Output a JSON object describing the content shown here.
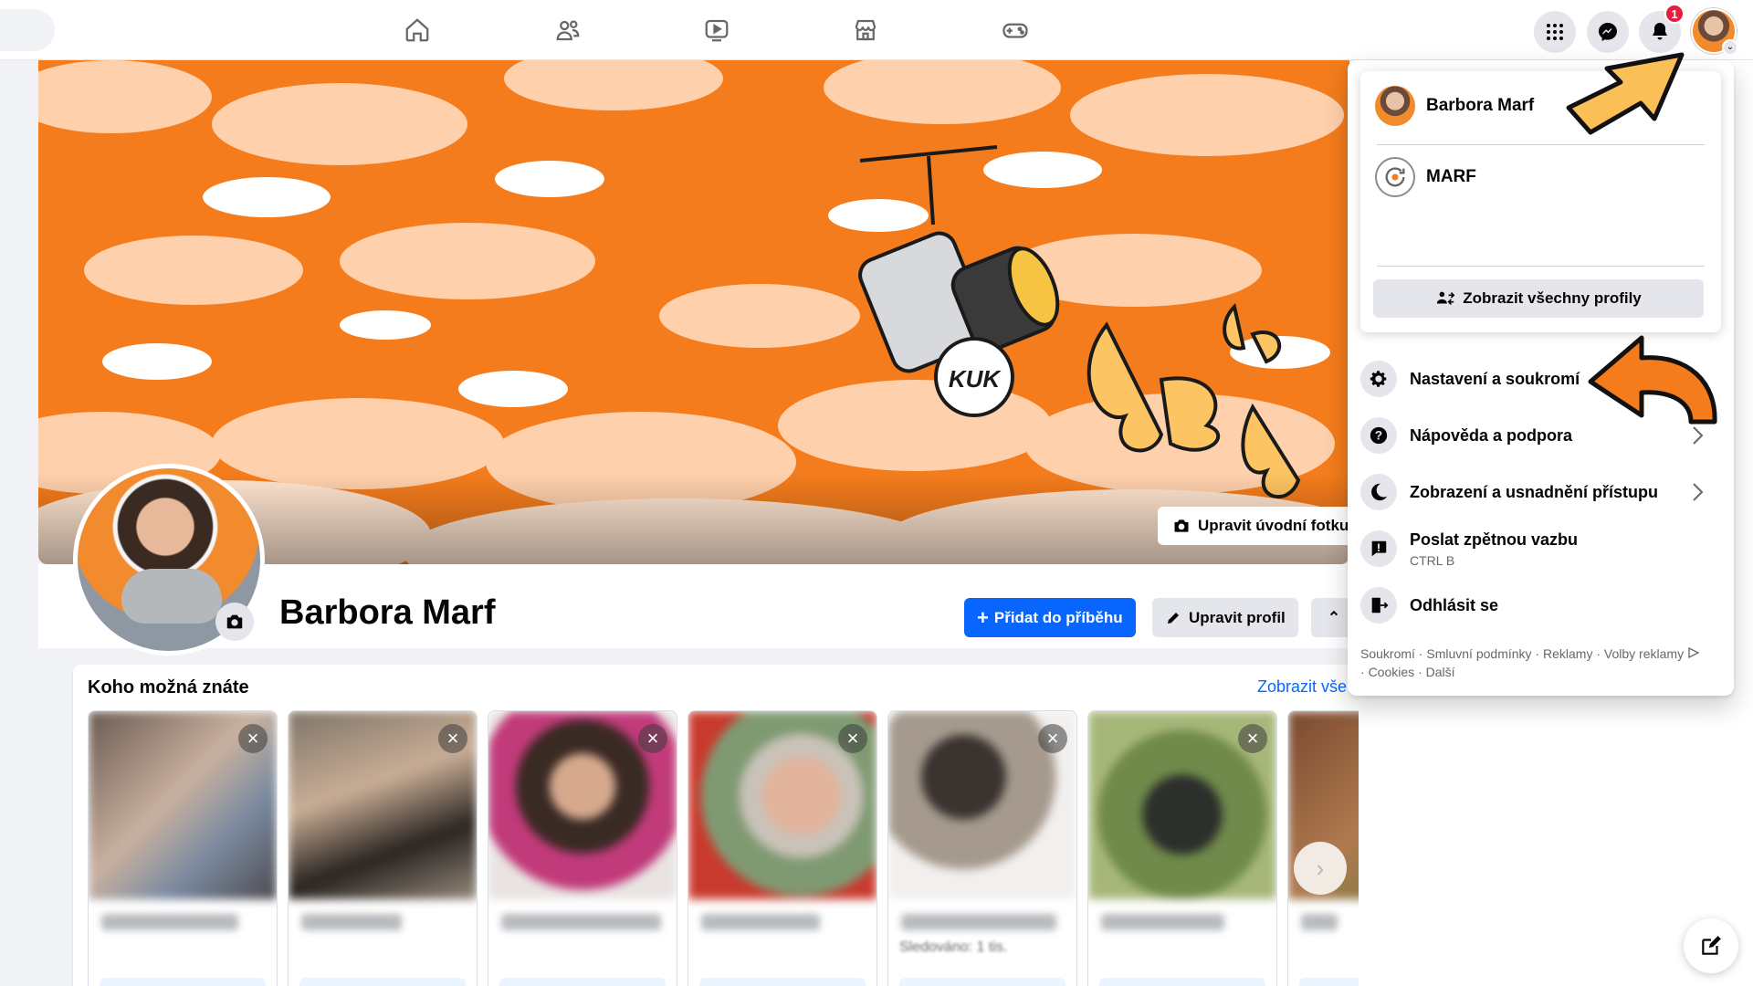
{
  "colors": {
    "accent": "#0866ff",
    "badge": "#e41e3f",
    "cover_orange": "#f47c1c",
    "annotation_yellow": "#fbbf57",
    "annotation_orange": "#f47c1c"
  },
  "topnav": {
    "icons": [
      "home-icon",
      "friends-icon",
      "video-icon",
      "marketplace-icon",
      "gaming-icon"
    ],
    "right_buttons": [
      "menu-grid-icon",
      "messenger-icon",
      "bell-icon"
    ],
    "notification_count": "1",
    "account_chevron": "⌄"
  },
  "cover": {
    "speech_bubble": "KUK",
    "edit_cover_label": "Upravit úvodní fotku"
  },
  "profile": {
    "name": "Barbora Marf",
    "add_story_label": "Přidat do příběhu",
    "edit_profile_label": "Upravit profil",
    "more_chevron": "⌃"
  },
  "pymk": {
    "title": "Koho možná znáte",
    "see_all": "Zobrazit vše",
    "close_glyph": "×",
    "card5_sub": "Sledováno: 1 tis.",
    "next_glyph": "›"
  },
  "menu": {
    "profiles": [
      {
        "name": "Barbora Marf"
      },
      {
        "name": "MARF"
      }
    ],
    "all_profiles_label": "Zobrazit všechny profily",
    "items": [
      {
        "label": "Nastavení a soukromí",
        "icon": "gear-icon"
      },
      {
        "label": "Nápověda a podpora",
        "icon": "help-icon"
      },
      {
        "label": "Zobrazení a usnadnění přístupu",
        "icon": "moon-icon"
      },
      {
        "label": "Poslat zpětnou vazbu",
        "sub": "CTRL B",
        "icon": "feedback-icon"
      },
      {
        "label": "Odhlásit se",
        "icon": "logout-icon"
      }
    ],
    "footer": {
      "privacy": "Soukromí",
      "terms": "Smluvní podmínky",
      "ads": "Reklamy",
      "ad_choices": "Volby reklamy",
      "cookies": "Cookies",
      "more": "Další",
      "sep": " · "
    }
  }
}
